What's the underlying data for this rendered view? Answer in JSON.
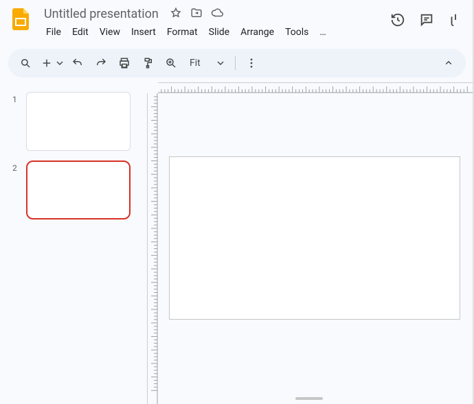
{
  "header": {
    "title": "Untitled presentation",
    "menu": [
      "File",
      "Edit",
      "View",
      "Insert",
      "Format",
      "Slide",
      "Arrange",
      "Tools",
      "…"
    ]
  },
  "toolbar": {
    "zoom_label": "Fit"
  },
  "filmstrip": {
    "slides": [
      {
        "number": "1",
        "selected": false
      },
      {
        "number": "2",
        "selected": true
      }
    ]
  }
}
